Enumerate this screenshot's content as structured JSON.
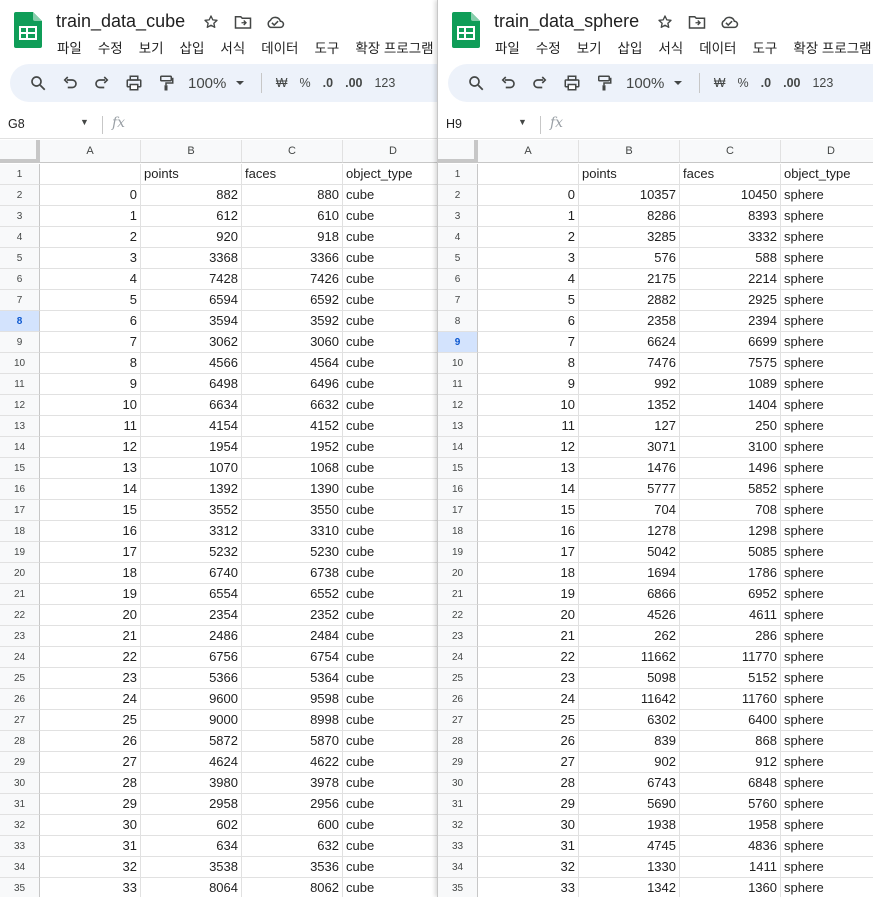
{
  "menu_items": [
    "파일",
    "수정",
    "보기",
    "삽입",
    "서식",
    "데이터",
    "도구",
    "확장 프로그램"
  ],
  "toolbar": {
    "zoom": "100%",
    "currency": "₩",
    "percent": "%",
    "dec_decrease": ".0",
    "dec_increase": ".00",
    "format_123": "123"
  },
  "fx_label": "fx",
  "column_letters": [
    "A",
    "B",
    "C",
    "D"
  ],
  "colors": {
    "sheets_green": "#0f9d58",
    "toolbar_bg": "#edf2fa",
    "active_row_bg": "#d3e3fd",
    "active_row_text": "#0b57d0"
  },
  "windows": [
    {
      "title": "train_data_cube",
      "name_box": "G8",
      "active_row": 8,
      "header": [
        "",
        "points",
        "faces",
        "object_type"
      ],
      "rows": [
        [
          0,
          882,
          880,
          "cube"
        ],
        [
          1,
          612,
          610,
          "cube"
        ],
        [
          2,
          920,
          918,
          "cube"
        ],
        [
          3,
          3368,
          3366,
          "cube"
        ],
        [
          4,
          7428,
          7426,
          "cube"
        ],
        [
          5,
          6594,
          6592,
          "cube"
        ],
        [
          6,
          3594,
          3592,
          "cube"
        ],
        [
          7,
          3062,
          3060,
          "cube"
        ],
        [
          8,
          4566,
          4564,
          "cube"
        ],
        [
          9,
          6498,
          6496,
          "cube"
        ],
        [
          10,
          6634,
          6632,
          "cube"
        ],
        [
          11,
          4154,
          4152,
          "cube"
        ],
        [
          12,
          1954,
          1952,
          "cube"
        ],
        [
          13,
          1070,
          1068,
          "cube"
        ],
        [
          14,
          1392,
          1390,
          "cube"
        ],
        [
          15,
          3552,
          3550,
          "cube"
        ],
        [
          16,
          3312,
          3310,
          "cube"
        ],
        [
          17,
          5232,
          5230,
          "cube"
        ],
        [
          18,
          6740,
          6738,
          "cube"
        ],
        [
          19,
          6554,
          6552,
          "cube"
        ],
        [
          20,
          2354,
          2352,
          "cube"
        ],
        [
          21,
          2486,
          2484,
          "cube"
        ],
        [
          22,
          6756,
          6754,
          "cube"
        ],
        [
          23,
          5366,
          5364,
          "cube"
        ],
        [
          24,
          9600,
          9598,
          "cube"
        ],
        [
          25,
          9000,
          8998,
          "cube"
        ],
        [
          26,
          5872,
          5870,
          "cube"
        ],
        [
          27,
          4624,
          4622,
          "cube"
        ],
        [
          28,
          3980,
          3978,
          "cube"
        ],
        [
          29,
          2958,
          2956,
          "cube"
        ],
        [
          30,
          602,
          600,
          "cube"
        ],
        [
          31,
          634,
          632,
          "cube"
        ],
        [
          32,
          3538,
          3536,
          "cube"
        ],
        [
          33,
          8064,
          8062,
          "cube"
        ]
      ]
    },
    {
      "title": "train_data_sphere",
      "name_box": "H9",
      "active_row": 9,
      "header": [
        "",
        "points",
        "faces",
        "object_type"
      ],
      "rows": [
        [
          0,
          10357,
          10450,
          "sphere"
        ],
        [
          1,
          8286,
          8393,
          "sphere"
        ],
        [
          2,
          3285,
          3332,
          "sphere"
        ],
        [
          3,
          576,
          588,
          "sphere"
        ],
        [
          4,
          2175,
          2214,
          "sphere"
        ],
        [
          5,
          2882,
          2925,
          "sphere"
        ],
        [
          6,
          2358,
          2394,
          "sphere"
        ],
        [
          7,
          6624,
          6699,
          "sphere"
        ],
        [
          8,
          7476,
          7575,
          "sphere"
        ],
        [
          9,
          992,
          1089,
          "sphere"
        ],
        [
          10,
          1352,
          1404,
          "sphere"
        ],
        [
          11,
          127,
          250,
          "sphere"
        ],
        [
          12,
          3071,
          3100,
          "sphere"
        ],
        [
          13,
          1476,
          1496,
          "sphere"
        ],
        [
          14,
          5777,
          5852,
          "sphere"
        ],
        [
          15,
          704,
          708,
          "sphere"
        ],
        [
          16,
          1278,
          1298,
          "sphere"
        ],
        [
          17,
          5042,
          5085,
          "sphere"
        ],
        [
          18,
          1694,
          1786,
          "sphere"
        ],
        [
          19,
          6866,
          6952,
          "sphere"
        ],
        [
          20,
          4526,
          4611,
          "sphere"
        ],
        [
          21,
          262,
          286,
          "sphere"
        ],
        [
          22,
          11662,
          11770,
          "sphere"
        ],
        [
          23,
          5098,
          5152,
          "sphere"
        ],
        [
          24,
          11642,
          11760,
          "sphere"
        ],
        [
          25,
          6302,
          6400,
          "sphere"
        ],
        [
          26,
          839,
          868,
          "sphere"
        ],
        [
          27,
          902,
          912,
          "sphere"
        ],
        [
          28,
          6743,
          6848,
          "sphere"
        ],
        [
          29,
          5690,
          5760,
          "sphere"
        ],
        [
          30,
          1938,
          1958,
          "sphere"
        ],
        [
          31,
          4745,
          4836,
          "sphere"
        ],
        [
          32,
          1330,
          1411,
          "sphere"
        ],
        [
          33,
          1342,
          1360,
          "sphere"
        ]
      ]
    }
  ]
}
